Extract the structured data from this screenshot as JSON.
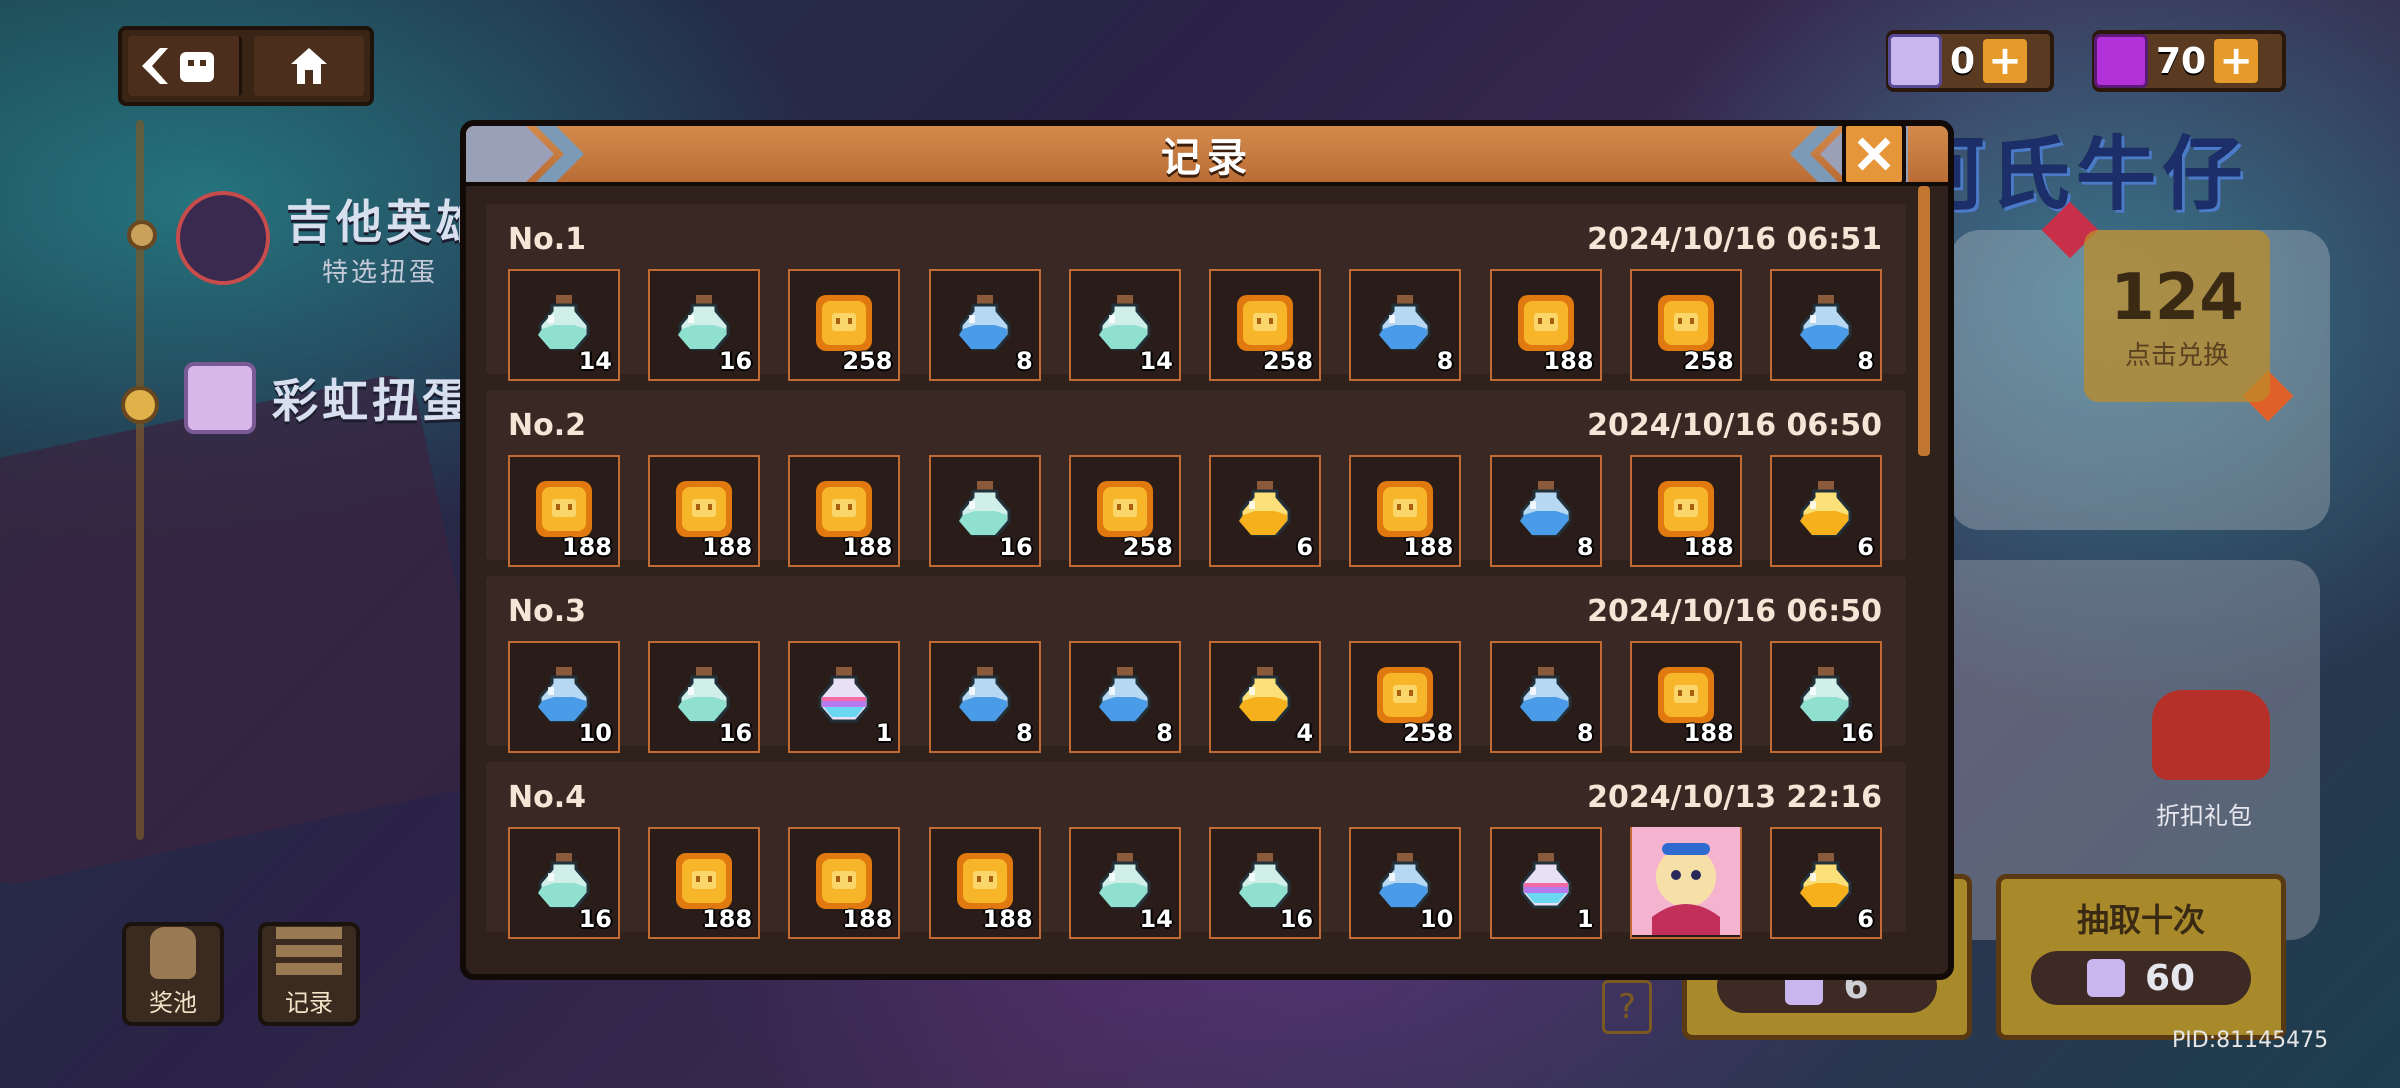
{
  "modal": {
    "title": "记录",
    "records": [
      {
        "no": "No.1",
        "time": "2024/10/16 06:51",
        "items": [
          {
            "icon": "teal-potion-icon",
            "count": "14"
          },
          {
            "icon": "teal-potion-icon",
            "count": "16"
          },
          {
            "icon": "gold-coin-icon",
            "count": "258"
          },
          {
            "icon": "blue-potion-icon",
            "count": "8"
          },
          {
            "icon": "teal-potion-icon",
            "count": "14"
          },
          {
            "icon": "gold-coin-icon",
            "count": "258"
          },
          {
            "icon": "blue-potion-icon",
            "count": "8"
          },
          {
            "icon": "gold-coin-icon",
            "count": "188"
          },
          {
            "icon": "gold-coin-icon",
            "count": "258"
          },
          {
            "icon": "blue-potion-icon",
            "count": "8"
          }
        ]
      },
      {
        "no": "No.2",
        "time": "2024/10/16 06:50",
        "items": [
          {
            "icon": "gold-coin-icon",
            "count": "188"
          },
          {
            "icon": "gold-coin-icon",
            "count": "188"
          },
          {
            "icon": "gold-coin-icon",
            "count": "188"
          },
          {
            "icon": "teal-potion-icon",
            "count": "16"
          },
          {
            "icon": "gold-coin-icon",
            "count": "258"
          },
          {
            "icon": "yellow-potion-icon",
            "count": "6"
          },
          {
            "icon": "gold-coin-icon",
            "count": "188"
          },
          {
            "icon": "blue-potion-icon",
            "count": "8"
          },
          {
            "icon": "gold-coin-icon",
            "count": "188"
          },
          {
            "icon": "yellow-potion-icon",
            "count": "6"
          }
        ]
      },
      {
        "no": "No.3",
        "time": "2024/10/16 06:50",
        "items": [
          {
            "icon": "blue-potion-icon",
            "count": "10"
          },
          {
            "icon": "teal-potion-icon",
            "count": "16"
          },
          {
            "icon": "rainbow-potion-icon",
            "count": "1"
          },
          {
            "icon": "blue-potion-icon",
            "count": "8"
          },
          {
            "icon": "blue-potion-icon",
            "count": "8"
          },
          {
            "icon": "yellow-potion-icon",
            "count": "4"
          },
          {
            "icon": "gold-coin-icon",
            "count": "258"
          },
          {
            "icon": "blue-potion-icon",
            "count": "8"
          },
          {
            "icon": "gold-coin-icon",
            "count": "188"
          },
          {
            "icon": "teal-potion-icon",
            "count": "16"
          }
        ]
      },
      {
        "no": "No.4",
        "time": "2024/10/13 22:16",
        "items": [
          {
            "icon": "teal-potion-icon",
            "count": "16"
          },
          {
            "icon": "gold-coin-icon",
            "count": "188"
          },
          {
            "icon": "gold-coin-icon",
            "count": "188"
          },
          {
            "icon": "gold-coin-icon",
            "count": "188"
          },
          {
            "icon": "teal-potion-icon",
            "count": "14"
          },
          {
            "icon": "teal-potion-icon",
            "count": "16"
          },
          {
            "icon": "blue-potion-icon",
            "count": "10"
          },
          {
            "icon": "rainbow-potion-icon",
            "count": "1"
          },
          {
            "icon": "character-skin-icon",
            "count": ""
          },
          {
            "icon": "yellow-potion-icon",
            "count": "6"
          }
        ]
      }
    ]
  },
  "currency": {
    "shirt_tickets": "0",
    "gems": "70"
  },
  "menu": {
    "item1_title": "吉他英雄",
    "item1_sub": "特选扭蛋",
    "item2_title": "彩虹扭蛋"
  },
  "bottom": {
    "pool_label": "奖池",
    "record_label": "记录"
  },
  "right": {
    "banner_title": "河氏牛仔",
    "points_value": "124",
    "points_label": "点击兑换",
    "gift_label": "折扣礼包",
    "draw_one_cost": "6",
    "draw_ten_label": "抽取十次",
    "draw_ten_cost": "60"
  },
  "pid": "PID:81145475",
  "colors": {
    "accent": "#c98a4e",
    "cell_border": "#c06a34",
    "coin": "#f0a020"
  }
}
